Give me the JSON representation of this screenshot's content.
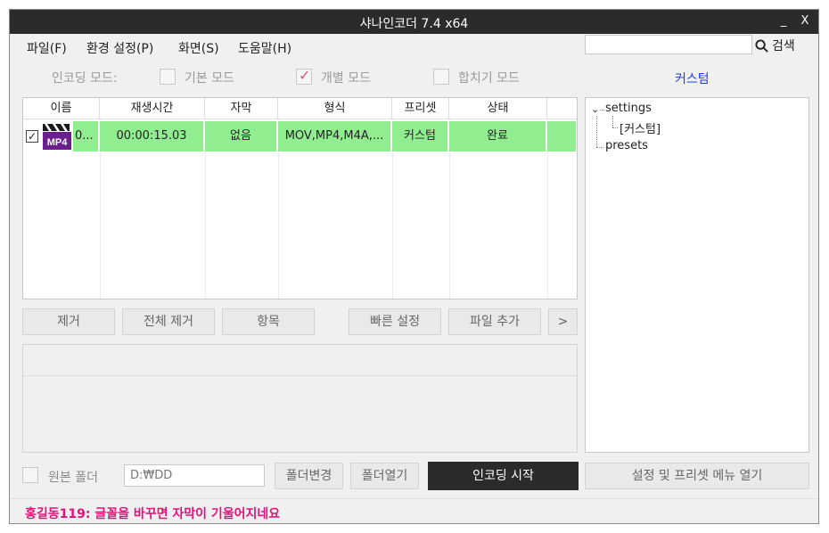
{
  "window": {
    "title": "샤나인코더  7.4 x64",
    "minimize": "_",
    "close": "X"
  },
  "menu": {
    "items": [
      "파일(F)",
      "환경 설정(P)",
      "화면(S)",
      "도움말(H)"
    ],
    "search_value": "",
    "search_label": "검색"
  },
  "mode": {
    "label": "인코딩 모드:",
    "options": [
      {
        "label": "기본 모드",
        "checked": false
      },
      {
        "label": "개별 모드",
        "checked": true
      },
      {
        "label": "합치기 모드",
        "checked": false
      }
    ],
    "current": "커스텀"
  },
  "file_list": {
    "columns": [
      "이름",
      "재생시간",
      "자막",
      "형식",
      "프리셋",
      "상태"
    ],
    "rows": [
      {
        "checked": true,
        "icon": "mp4-icon",
        "icon_text": "MP4",
        "name": "0...",
        "duration": "00:00:15.03",
        "subtitle": "없음",
        "format": "MOV,MP4,M4A,...",
        "preset": "커스텀",
        "status": "완료"
      }
    ]
  },
  "buttons": {
    "remove": "제거",
    "remove_all": "전체 제거",
    "items": "항목",
    "quick_settings": "빠른 설정",
    "add_file": "파일 추가",
    "more": ">"
  },
  "tree": {
    "root": "settings",
    "child": "[커스텀]",
    "sibling": "presets"
  },
  "output": {
    "source_folder_label": "원본 폴더",
    "folder_path": "D:₩DD",
    "change_folder": "폴더변경",
    "open_folder": "폴더열기",
    "start_encoding": "인코딩 시작",
    "open_settings_menu": "설정 및 프리셋 메뉴 열기"
  },
  "status": {
    "message": "홍길동119: 글꼴을 바꾸면 자막이 기울어지네요"
  },
  "colors": {
    "title_bg": "#2b2b2b",
    "row_done": "#90ee90",
    "accent_blue": "#1f3de0",
    "status_pink": "#e0157a",
    "highlight_line": "#d0202a"
  }
}
